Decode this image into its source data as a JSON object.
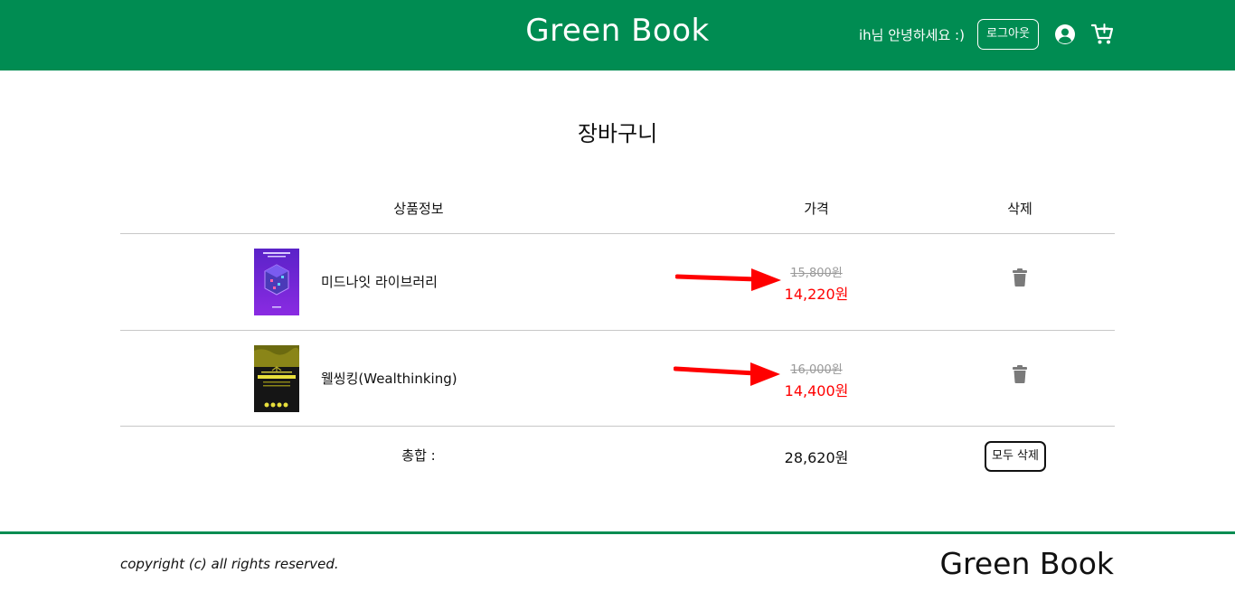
{
  "header": {
    "brand": "Green Book",
    "greeting": "ih님 안녕하세요 :)",
    "logout_label": "로그아웃",
    "user_icon": "user-circle-icon",
    "cart_icon": "cart-icon",
    "bg_color": "#008c52"
  },
  "page": {
    "title": "장바구니"
  },
  "table": {
    "columns": {
      "product": "상품정보",
      "price": "가격",
      "delete": "삭제"
    },
    "items": [
      {
        "title": "미드나잇 라이브러리",
        "original_price": "15,800원",
        "sale_price": "14,220원"
      },
      {
        "title": "웰씽킹(Wealthinking)",
        "original_price": "16,000원",
        "sale_price": "14,400원"
      }
    ],
    "total_label": "총합 :",
    "total_value": "28,620원",
    "clear_all_label": "모두 삭제"
  },
  "footer": {
    "copyright": "copyright (c) all rights reserved.",
    "brand": "Green Book"
  },
  "colors": {
    "brand_green": "#008c52",
    "sale_red": "#ff0000",
    "arrow_red": "#ff0000"
  }
}
